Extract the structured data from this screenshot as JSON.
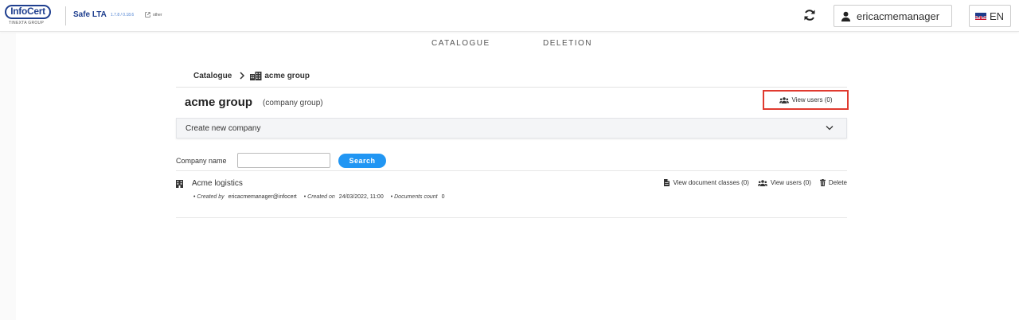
{
  "header": {
    "logo_text": "InfoCert",
    "logo_subtext": "TINEXTA GROUP",
    "app_name": "Safe LTA",
    "app_version": "1.7.8 / 0.18.6",
    "app_link": "other",
    "user_name": "ericacmemanager",
    "language": "EN"
  },
  "nav": {
    "catalogue": "CATALOGUE",
    "deletion": "DELETION"
  },
  "breadcrumb": {
    "root": "Catalogue",
    "current": "acme group"
  },
  "page": {
    "title": "acme group",
    "subtitle": "(company group)",
    "view_users": "View users (0)",
    "accordion_label": "Create new company"
  },
  "search": {
    "label": "Company name",
    "value": "",
    "placeholder": "",
    "button": "Search"
  },
  "companies": [
    {
      "name": "Acme logistics",
      "created_by_label": "Created by",
      "created_by": "ericacmemanager@infocert",
      "created_on_label": "Created on",
      "created_on": "24/03/2022, 11:00",
      "documents_count_label": "Documents count",
      "documents_count": "0",
      "actions": {
        "view_document_classes": "View document classes (0)",
        "view_users": "View users (0)",
        "delete": "Delete"
      }
    }
  ],
  "colors": {
    "brand": "#1f3f8f",
    "primary_button": "#2196f3",
    "highlight_border": "#e03a2f"
  }
}
